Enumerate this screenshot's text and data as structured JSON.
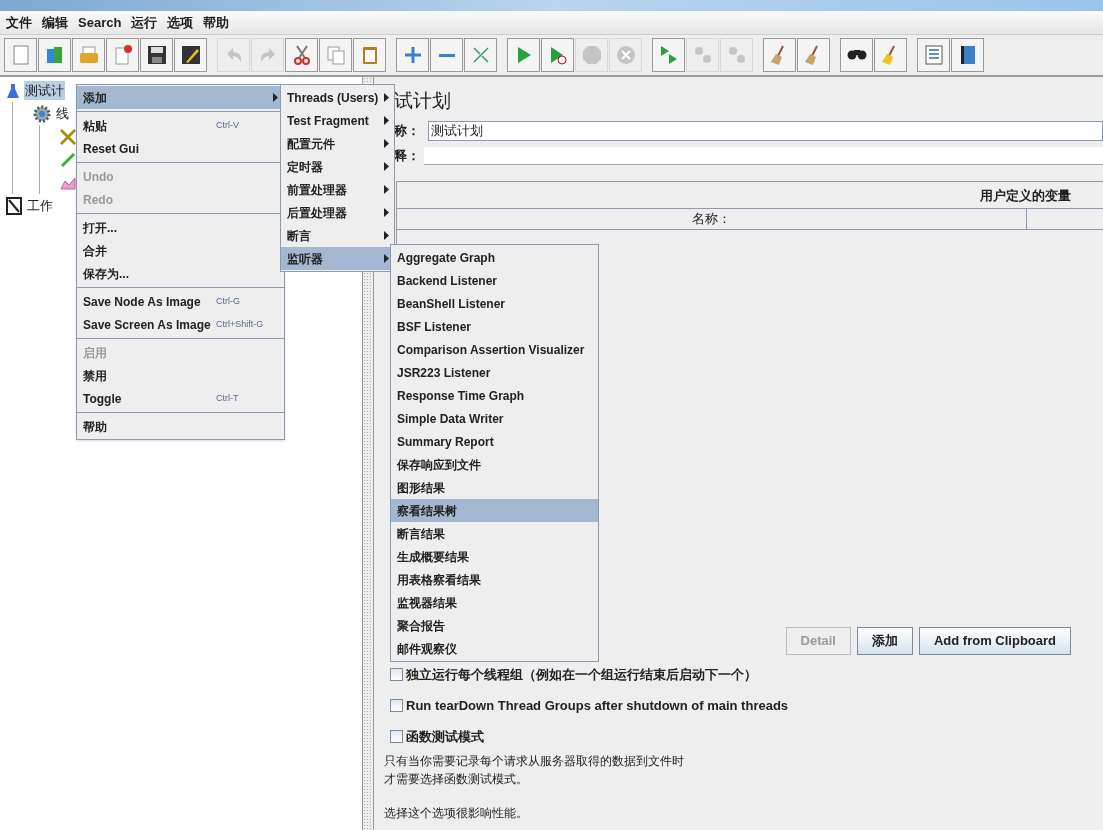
{
  "menubar": [
    "文件",
    "编辑",
    "Search",
    "运行",
    "选项",
    "帮助"
  ],
  "toolbar": [
    [
      {
        "kind": "new",
        "disabled": false
      },
      {
        "kind": "templates",
        "disabled": false
      },
      {
        "kind": "open",
        "disabled": false
      },
      {
        "kind": "close",
        "disabled": false
      },
      {
        "kind": "save",
        "disabled": false
      },
      {
        "kind": "save-as",
        "disabled": false
      }
    ],
    [
      {
        "kind": "undo",
        "disabled": true
      },
      {
        "kind": "redo",
        "disabled": true
      },
      {
        "kind": "cut",
        "disabled": false
      },
      {
        "kind": "copy",
        "disabled": false
      },
      {
        "kind": "paste",
        "disabled": false
      }
    ],
    [
      {
        "kind": "expand",
        "disabled": false
      },
      {
        "kind": "collapse",
        "disabled": false
      },
      {
        "kind": "toggle",
        "disabled": false
      }
    ],
    [
      {
        "kind": "start",
        "disabled": false
      },
      {
        "kind": "start-no-pause",
        "disabled": false
      },
      {
        "kind": "stop",
        "disabled": true
      },
      {
        "kind": "shutdown",
        "disabled": true
      }
    ],
    [
      {
        "kind": "remote-start",
        "disabled": false
      },
      {
        "kind": "remote-stop",
        "disabled": true
      },
      {
        "kind": "remote-shutdown",
        "disabled": true
      }
    ],
    [
      {
        "kind": "clear",
        "disabled": false
      },
      {
        "kind": "clear-all",
        "disabled": false
      }
    ],
    [
      {
        "kind": "search",
        "disabled": false
      },
      {
        "kind": "reset-search",
        "disabled": false
      }
    ],
    [
      {
        "kind": "function-helper",
        "disabled": false
      },
      {
        "kind": "help",
        "disabled": false
      }
    ]
  ],
  "tree": [
    {
      "label": "测试计",
      "kind": "flask",
      "selected": true,
      "children": [
        {
          "label": "线",
          "kind": "gear",
          "selected": false,
          "children": [
            {
              "kind": "tools"
            },
            {
              "kind": "pipette"
            },
            {
              "kind": "graph"
            }
          ]
        }
      ]
    },
    {
      "label": "工作",
      "kind": "workbench",
      "selected": false
    }
  ],
  "context_menu": [
    {
      "kind": "item",
      "label": "添加",
      "submenu": true,
      "selected": true,
      "disabled": false
    },
    {
      "kind": "separator"
    },
    {
      "kind": "item",
      "label": "粘贴",
      "shortcut": "Ctrl-V",
      "submenu": false,
      "selected": false,
      "disabled": false
    },
    {
      "kind": "item",
      "label": "Reset Gui",
      "submenu": false,
      "selected": false,
      "disabled": false
    },
    {
      "kind": "separator"
    },
    {
      "kind": "item",
      "label": "Undo",
      "submenu": false,
      "selected": false,
      "disabled": true
    },
    {
      "kind": "item",
      "label": "Redo",
      "submenu": false,
      "selected": false,
      "disabled": true
    },
    {
      "kind": "separator"
    },
    {
      "kind": "item",
      "label": "打开...",
      "submenu": false,
      "selected": false,
      "disabled": false
    },
    {
      "kind": "item",
      "label": "合并",
      "submenu": false,
      "selected": false,
      "disabled": false
    },
    {
      "kind": "item",
      "label": "保存为...",
      "submenu": false,
      "selected": false,
      "disabled": false
    },
    {
      "kind": "separator"
    },
    {
      "kind": "item",
      "label": "Save Node As Image",
      "shortcut": "Ctrl-G",
      "submenu": false,
      "selected": false,
      "disabled": false
    },
    {
      "kind": "item",
      "label": "Save Screen As Image",
      "shortcut": "Ctrl+Shift-G",
      "submenu": false,
      "selected": false,
      "disabled": false
    },
    {
      "kind": "separator"
    },
    {
      "kind": "item",
      "label": "启用",
      "submenu": false,
      "selected": false,
      "disabled": true
    },
    {
      "kind": "item",
      "label": "禁用",
      "submenu": false,
      "selected": false,
      "disabled": false
    },
    {
      "kind": "item",
      "label": "Toggle",
      "shortcut": "Ctrl-T",
      "submenu": false,
      "selected": false,
      "disabled": false
    },
    {
      "kind": "separator"
    },
    {
      "kind": "item",
      "label": "帮助",
      "submenu": false,
      "selected": false,
      "disabled": false
    }
  ],
  "add_submenu": [
    {
      "label": "Threads (Users)",
      "selected": false
    },
    {
      "label": "Test Fragment",
      "selected": false
    },
    {
      "label": "配置元件",
      "selected": false
    },
    {
      "label": "定时器",
      "selected": false
    },
    {
      "label": "前置处理器",
      "selected": false
    },
    {
      "label": "后置处理器",
      "selected": false
    },
    {
      "label": "断言",
      "selected": false
    },
    {
      "label": "监听器",
      "selected": true
    }
  ],
  "listener_submenu": [
    {
      "label": "Aggregate Graph",
      "selected": false
    },
    {
      "label": "Backend Listener",
      "selected": false
    },
    {
      "label": "BeanShell Listener",
      "selected": false
    },
    {
      "label": "BSF Listener",
      "selected": false
    },
    {
      "label": "Comparison Assertion Visualizer",
      "selected": false
    },
    {
      "label": "JSR223 Listener",
      "selected": false
    },
    {
      "label": "Response Time Graph",
      "selected": false
    },
    {
      "label": "Simple Data Writer",
      "selected": false
    },
    {
      "label": "Summary Report",
      "selected": false
    },
    {
      "label": "保存响应到文件",
      "selected": false
    },
    {
      "label": "图形结果",
      "selected": false
    },
    {
      "label": "察看结果树",
      "selected": true
    },
    {
      "label": "断言结果",
      "selected": false
    },
    {
      "label": "生成概要结果",
      "selected": false
    },
    {
      "label": "用表格察看结果",
      "selected": false
    },
    {
      "label": "监视器结果",
      "selected": false
    },
    {
      "label": "聚合报告",
      "selected": false
    },
    {
      "label": "邮件观察仪",
      "selected": false
    }
  ],
  "panel": {
    "title": "试计划",
    "name_label": "称：",
    "name_value": "测试计划",
    "comment_label": "释：",
    "variables": {
      "title": "用户定义的变量",
      "columns": [
        "名称："
      ]
    },
    "buttons": [
      {
        "label": "Detail",
        "disabled": true
      },
      {
        "label": "添加",
        "disabled": false
      },
      {
        "label": "Add from Clipboard",
        "disabled": false
      }
    ],
    "options": [
      {
        "label": "独立运行每个线程组（例如在一个组运行结束后启动下一个）",
        "checked": false
      },
      {
        "label": "Run tearDown Thread Groups after shutdown of main threads",
        "checked": false
      },
      {
        "label": "函数测试模式",
        "checked": false
      }
    ],
    "notes": [
      "只有当你需要记录每个请求从服务器取得的数据到文件时",
      "才需要选择函数测试模式。",
      "选择这个选项很影响性能。"
    ]
  }
}
